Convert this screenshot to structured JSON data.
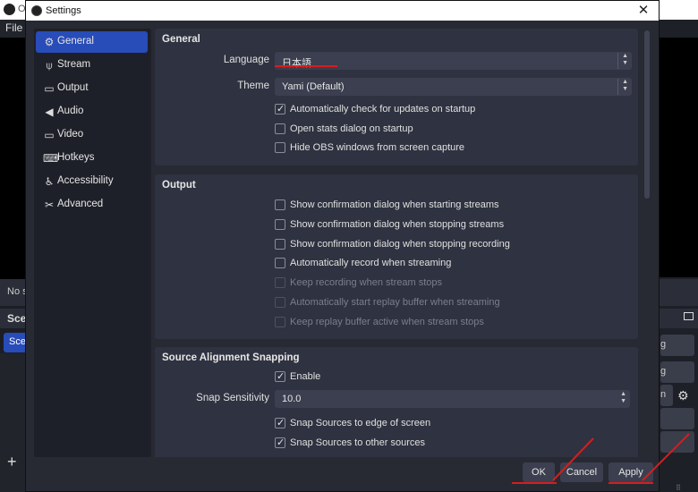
{
  "background": {
    "title_partial": "Ol",
    "menu_file": "File",
    "no_source_partial": "No s",
    "scenes_partial": "Scer",
    "scene_item_partial": "Scer",
    "right_btn_1": "g",
    "right_btn_2": "g",
    "right_btn_3": "n",
    "plus": "+"
  },
  "dialog": {
    "title": "Settings",
    "close": "✕"
  },
  "sidebar": {
    "items": [
      {
        "label": "General",
        "icon": "gear-icon",
        "glyph": "⚙",
        "active": true
      },
      {
        "label": "Stream",
        "icon": "antenna-icon",
        "glyph": "⍦",
        "active": false
      },
      {
        "label": "Output",
        "icon": "output-icon",
        "glyph": "▭",
        "active": false
      },
      {
        "label": "Audio",
        "icon": "speaker-icon",
        "glyph": "◀",
        "active": false
      },
      {
        "label": "Video",
        "icon": "monitor-icon",
        "glyph": "▭",
        "active": false
      },
      {
        "label": "Hotkeys",
        "icon": "keyboard-icon",
        "glyph": "⌨",
        "active": false
      },
      {
        "label": "Accessibility",
        "icon": "accessibility-icon",
        "glyph": "♿",
        "active": false
      },
      {
        "label": "Advanced",
        "icon": "tools-icon",
        "glyph": "✂",
        "active": false
      }
    ]
  },
  "general": {
    "title": "General",
    "language_label": "Language",
    "language_value": "日本語",
    "theme_label": "Theme",
    "theme_value": "Yami (Default)",
    "checks": [
      {
        "label": "Automatically check for updates on startup",
        "checked": true
      },
      {
        "label": "Open stats dialog on startup",
        "checked": false
      },
      {
        "label": "Hide OBS windows from screen capture",
        "checked": false
      }
    ]
  },
  "output": {
    "title": "Output",
    "checks": [
      {
        "label": "Show confirmation dialog when starting streams",
        "checked": false,
        "disabled": false
      },
      {
        "label": "Show confirmation dialog when stopping streams",
        "checked": false,
        "disabled": false
      },
      {
        "label": "Show confirmation dialog when stopping recording",
        "checked": false,
        "disabled": false
      },
      {
        "label": "Automatically record when streaming",
        "checked": false,
        "disabled": false
      },
      {
        "label": "Keep recording when stream stops",
        "checked": false,
        "disabled": true
      },
      {
        "label": "Automatically start replay buffer when streaming",
        "checked": false,
        "disabled": true
      },
      {
        "label": "Keep replay buffer active when stream stops",
        "checked": false,
        "disabled": true
      }
    ]
  },
  "snapping": {
    "title": "Source Alignment Snapping",
    "enable_label": "Enable",
    "enable_checked": true,
    "sensitivity_label": "Snap Sensitivity",
    "sensitivity_value": "10.0",
    "checks": [
      {
        "label": "Snap Sources to edge of screen",
        "checked": true
      },
      {
        "label": "Snap Sources to other sources",
        "checked": true
      }
    ]
  },
  "buttons": {
    "ok": "OK",
    "cancel": "Cancel",
    "apply": "Apply"
  },
  "colors": {
    "accent": "#284cb8",
    "annotation_red": "#d81d1d",
    "panel": "#2f3240",
    "dialog_bg": "#272a33"
  }
}
